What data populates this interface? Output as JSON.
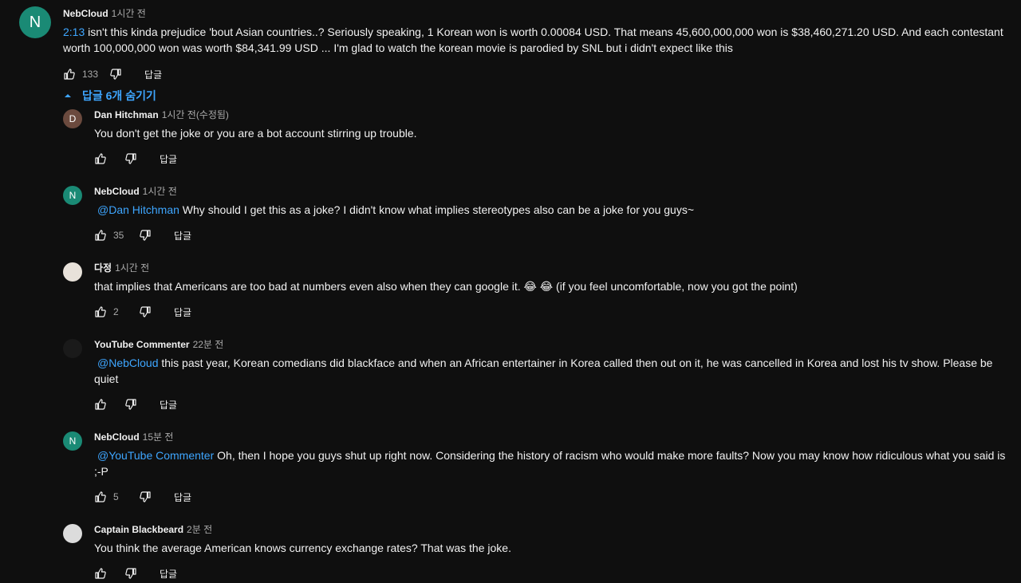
{
  "main_comment": {
    "avatar_letter": "N",
    "author": "NebCloud",
    "time": "1시간 전",
    "timestamp_link": "2:13",
    "text": " isn't this kinda prejudice 'bout Asian countries..? Seriously speaking, 1 Korean won is worth 0.00084 USD. That means 45,600,000,000 won is $38,460,271.20 USD. And each contestant worth 100,000,000 won was worth $84,341.99 USD ... I'm glad to watch the korean movie is parodied by SNL but i didn't expect like this",
    "likes": "133",
    "reply_label": "답글"
  },
  "replies_toggle": "답글 6개 숨기기",
  "replies": [
    {
      "avatar_letter": "D",
      "avatar_color": "#6b4a3e",
      "author": "Dan Hitchman",
      "time": "1시간 전(수정됨)",
      "mention": "",
      "text": "You don't get the joke or you are a bot account stirring up trouble.",
      "likes": "",
      "reply_label": "답글"
    },
    {
      "avatar_letter": "N",
      "avatar_color": "#1a8a75",
      "author": "NebCloud",
      "time": "1시간 전",
      "mention": "@Dan Hitchman",
      "text": "  Why should I get this as a joke? I didn't know what implies stereotypes also can be a joke for you guys~",
      "likes": "35",
      "reply_label": "답글"
    },
    {
      "avatar_letter": "",
      "avatar_color": "#e8e2da",
      "author": "다정",
      "time": "1시간 전",
      "mention": "",
      "text": "that implies that Americans are too bad at numbers even also when they can google it. 😂 😂 (if you feel uncomfortable, now you got the point)",
      "likes": "2",
      "reply_label": "답글"
    },
    {
      "avatar_letter": "",
      "avatar_color": "#1a1a1a",
      "author": "YouTube Commenter",
      "time": "22분 전",
      "mention": "@NebCloud",
      "text": "  this past year, Korean comedians did blackface and when an African entertainer in Korea called then out on it, he was cancelled in Korea and lost his tv show. Please be quiet",
      "likes": "",
      "reply_label": "답글"
    },
    {
      "avatar_letter": "N",
      "avatar_color": "#1a8a75",
      "author": "NebCloud",
      "time": "15분 전",
      "mention": "@YouTube Commenter",
      "text": "  Oh, then I hope you guys shut up right now. Considering the history of racism who would make more faults? Now you may know how ridiculous what you said is ;-P",
      "likes": "5",
      "reply_label": "답글"
    },
    {
      "avatar_letter": "",
      "avatar_color": "#dcdcdc",
      "author": "Captain Blackbeard",
      "time": "2분 전",
      "mention": "",
      "text": "You think the average American knows currency exchange rates?  That was the joke.",
      "likes": "",
      "reply_label": "답글"
    }
  ]
}
